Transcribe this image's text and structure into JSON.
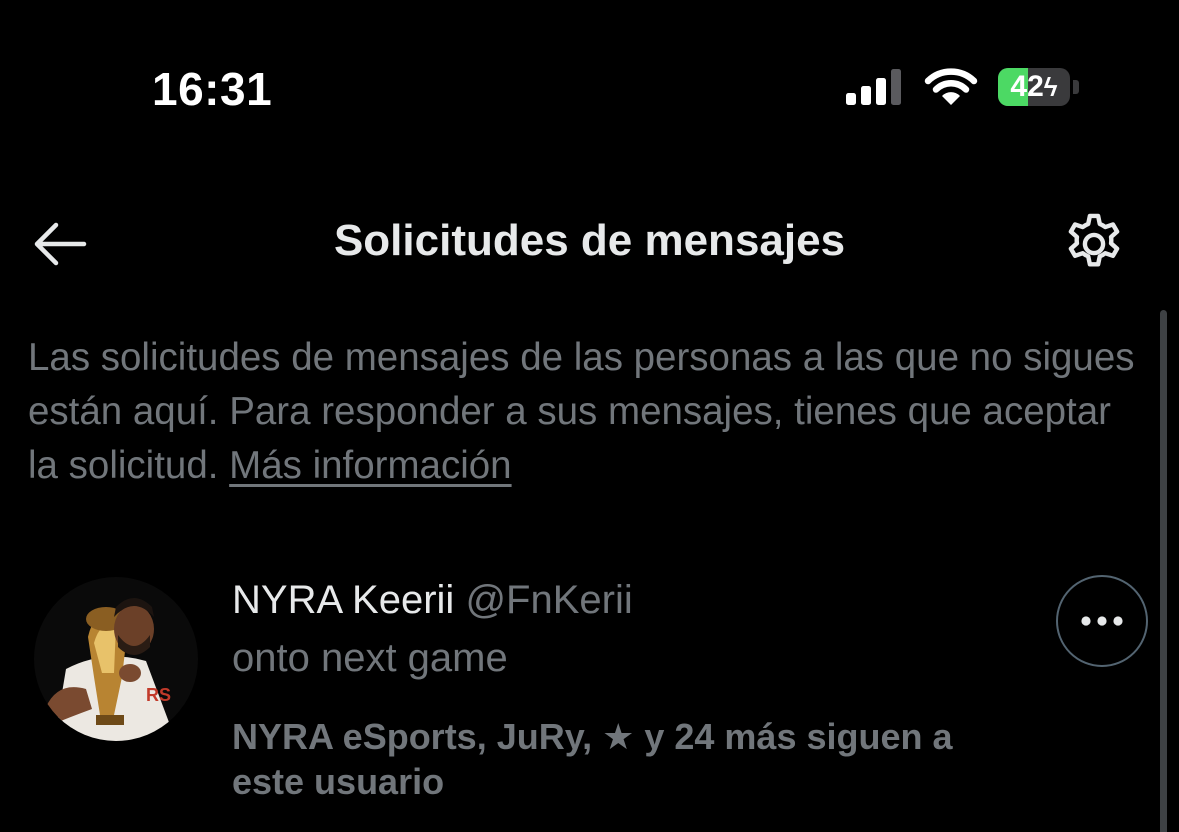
{
  "status_bar": {
    "time": "16:31",
    "battery_percent": "42",
    "battery_level": 0.42,
    "battery_color": "#4cd964",
    "icons": [
      "cellular-signal-icon",
      "wifi-icon",
      "battery-charging-icon"
    ]
  },
  "header": {
    "title": "Solicitudes de mensajes",
    "back_icon": "arrow-left-icon",
    "settings_icon": "gear-icon"
  },
  "description": {
    "text": "Las solicitudes de mensajes de las personas a las que no sigues están aquí. Para responder a sus mensajes, tienes que aceptar la solicitud.",
    "link": "Más información"
  },
  "requests": [
    {
      "display_name": "NYRA Keerii",
      "handle": "@FnKerii",
      "preview": "onto next game",
      "followed_by": "NYRA eSports, JuRy, ★ y 24 más siguen a este usuario",
      "more_icon": "more-horizontal-icon"
    }
  ],
  "colors": {
    "background": "#000000",
    "primary_text": "#e7e9ea",
    "secondary_text": "#71767b",
    "border": "#536471"
  }
}
